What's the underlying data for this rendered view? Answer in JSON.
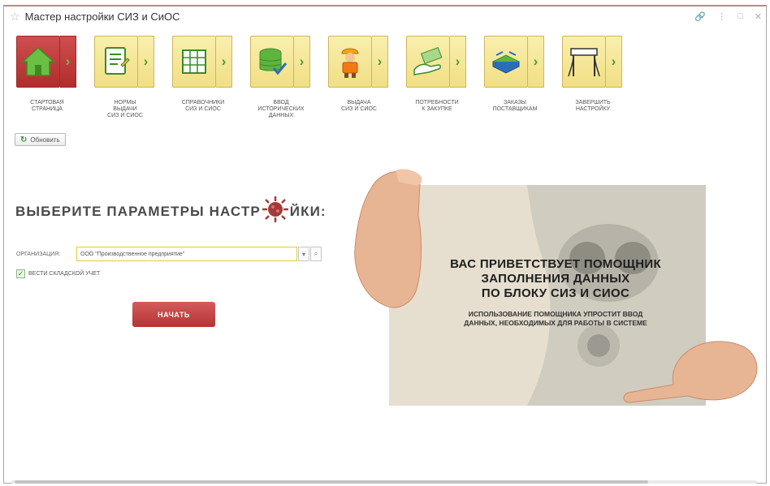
{
  "window": {
    "title": "Мастер настройки СИЗ и СиОС",
    "controls": [
      "link-icon",
      "more-icon",
      "maximize-icon",
      "close-icon"
    ]
  },
  "steps": [
    {
      "label": "Стартовая\nстраница",
      "icon": "home-icon",
      "active": true
    },
    {
      "label": "Нормы\nвыдачи\nСИЗ и СиОС",
      "icon": "document-icon",
      "active": false
    },
    {
      "label": "Справочники\nСИЗ и СиОС",
      "icon": "catalog-icon",
      "active": false
    },
    {
      "label": "Ввод\nисторических\nданных",
      "icon": "database-check-icon",
      "active": false
    },
    {
      "label": "Выдача\nСИЗ и СиОС",
      "icon": "worker-icon",
      "active": false
    },
    {
      "label": "Потребности\nк закупке",
      "icon": "money-hand-icon",
      "active": false
    },
    {
      "label": "Заказы\nпоставщикам",
      "icon": "tray-arrows-icon",
      "active": false
    },
    {
      "label": "Завершить\nнастройку",
      "icon": "finish-gate-icon",
      "active": false
    }
  ],
  "toolbar": {
    "refresh_label": "Обновить"
  },
  "heading": {
    "part1": "ВЫБЕРИТЕ ПАРАМЕТРЫ НАСТР",
    "part2": "ЙКИ:"
  },
  "form": {
    "org_label": "ОРГАНИЗАЦИЯ:",
    "org_value": "ООО \"Производственное предприятие\"",
    "warehouse_label": "ВЕСТИ СКЛАДСКОЙ УЧЕТ",
    "warehouse_checked": true
  },
  "start_button": "НАЧАТЬ",
  "banner": {
    "title": "ВАС ПРИВЕТСТВУЕТ ПОМОЩНИК\nЗАПОЛНЕНИЯ ДАННЫХ\nПО БЛОКУ СИЗ И СИОС",
    "subtitle": "ИСПОЛЬЗОВАНИЕ ПОМОЩНИКА УПРОСТИТ ВВОД\nДАННЫХ, НЕОБХОДИМЫХ ДЛЯ РАБОТЫ В СИСТЕМЕ"
  },
  "colors": {
    "accent_red": "#b63333",
    "tile_yellow": "#f5e69a",
    "arrow_green": "#4a9a26",
    "field_border": "#e3c93a"
  }
}
